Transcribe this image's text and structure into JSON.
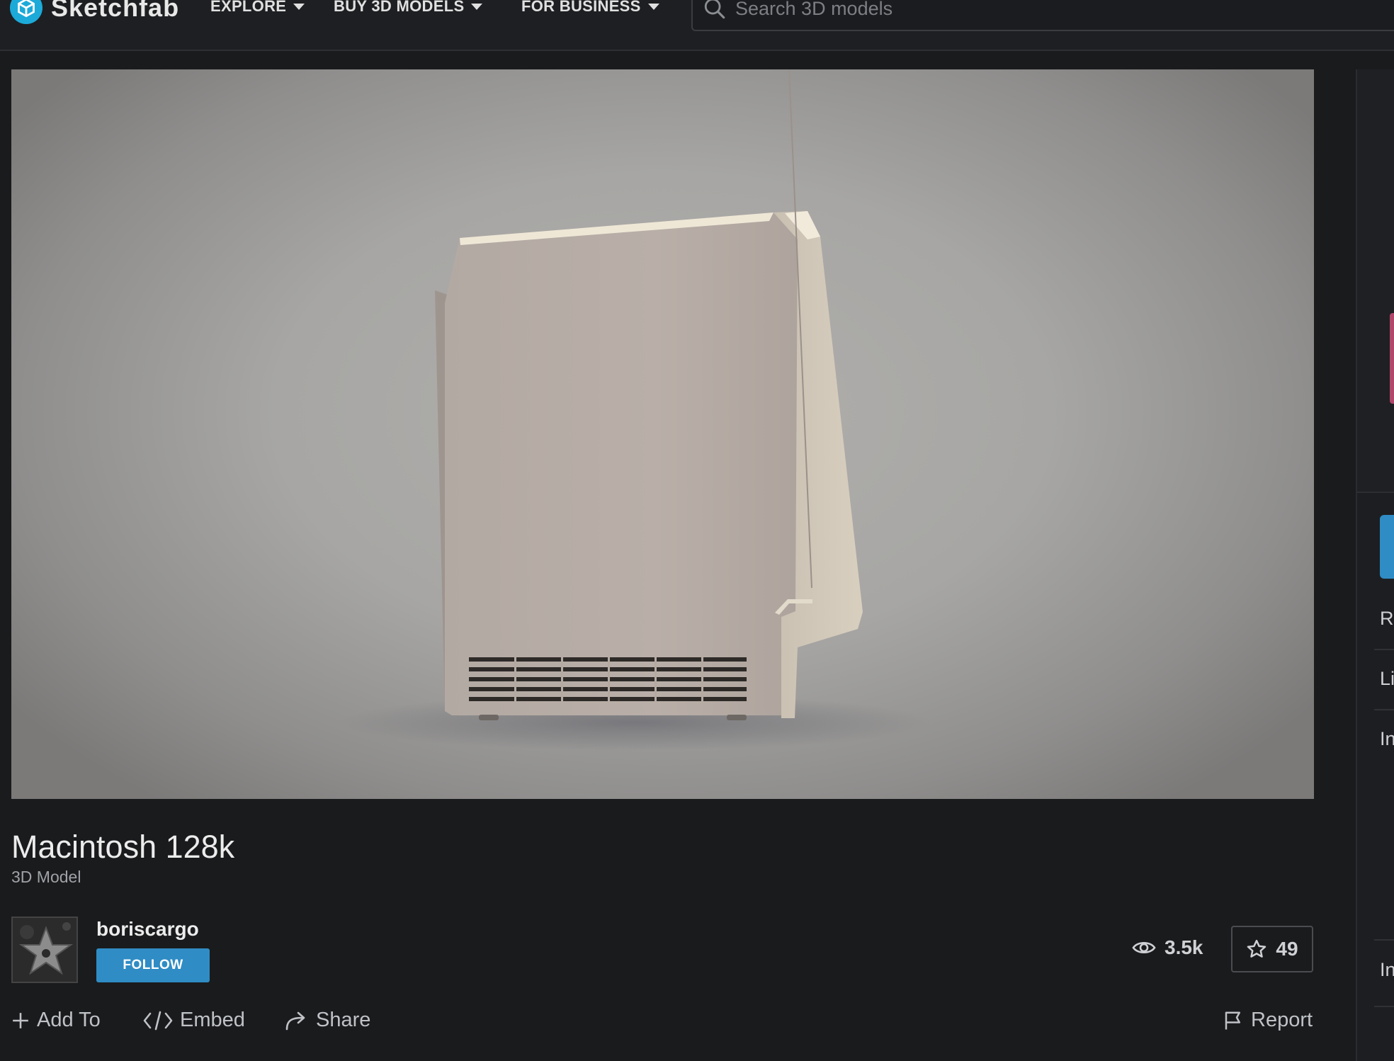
{
  "brand": {
    "name": "Sketchfab",
    "accent": "#1caad9"
  },
  "nav": {
    "items": [
      "EXPLORE",
      "BUY 3D MODELS",
      "FOR BUSINESS"
    ],
    "search_placeholder": "Search 3D models"
  },
  "model": {
    "title": "Macintosh 128k",
    "type": "3D Model"
  },
  "author": {
    "name": "boriscargo",
    "follow_label": "FOLLOW"
  },
  "stats": {
    "views": "3.5k",
    "likes": "49"
  },
  "actions": {
    "add_to": "Add To",
    "embed": "Embed",
    "share": "Share",
    "report": "Report"
  },
  "side_panel": {
    "letters": [
      "R",
      "Li",
      "In",
      "In"
    ]
  },
  "colors": {
    "background": "#1a1b1d",
    "follow_button": "#2f8cc4",
    "side_highlight": "#b0476b"
  }
}
